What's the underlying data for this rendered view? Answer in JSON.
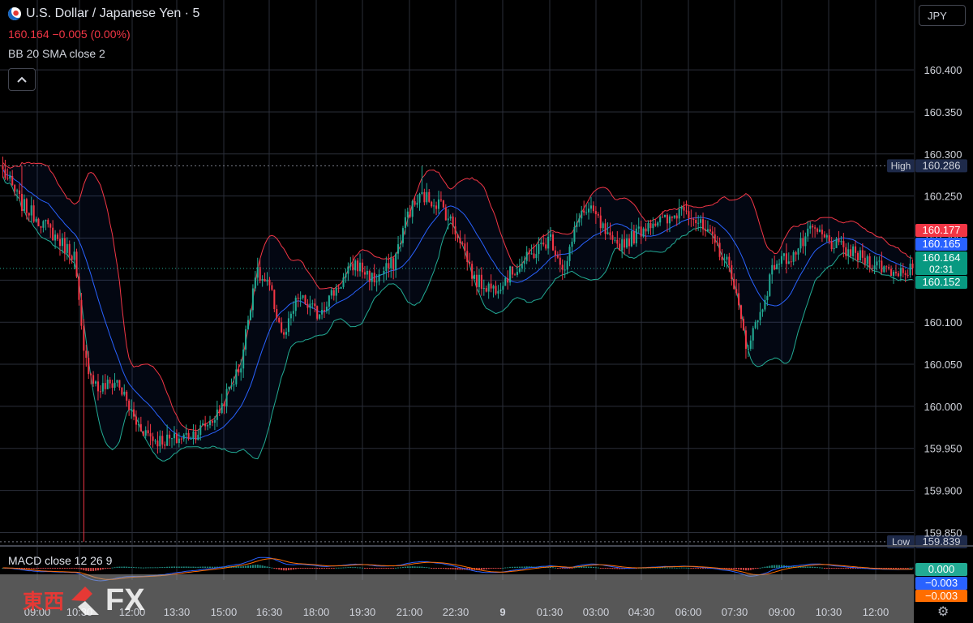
{
  "header": {
    "title": "U.S. Dollar / Japanese Yen · 5",
    "price_line": "160.164 −0.005 (0.00%)",
    "indicator": "BB 20 SMA close 2",
    "currency": "JPY"
  },
  "icons": {
    "flag": "usd-jpy-flag-icon",
    "collapse": "chevron-up-icon",
    "settings": "gear-icon"
  },
  "macd": {
    "label": "MACD close 12 26 9"
  },
  "logo": {
    "text": "東西",
    "suffix": "FX"
  },
  "colors": {
    "background": "#000000",
    "up": "#22ab94",
    "down": "#f23645",
    "bb_upper": "#f23645",
    "bb_basis": "#2962ff",
    "bb_lower": "#22ab94",
    "macd_line": "#2962ff",
    "signal_line": "#ff6d00",
    "high_low_label": "#1e2a4a"
  },
  "chart_data": {
    "type": "candlestick",
    "symbol": "USD/JPY",
    "interval": "5",
    "ylim": [
      159.835,
      160.43
    ],
    "y_ticks": [
      "160.400",
      "160.350",
      "160.300",
      "160.250",
      "160.200",
      "160.150",
      "160.100",
      "160.050",
      "160.000",
      "159.950",
      "159.900",
      "159.850"
    ],
    "x_ticks": [
      "09:00",
      "10:30",
      "12:00",
      "13:30",
      "15:00",
      "16:30",
      "18:00",
      "19:30",
      "21:00",
      "22:30",
      "9",
      "01:30",
      "03:00",
      "04:30",
      "06:00",
      "07:30",
      "09:00",
      "10:30",
      "12:00"
    ],
    "price_labels": [
      {
        "label": "High",
        "value": "160.286"
      },
      {
        "label": "Low",
        "value": "159.839"
      }
    ],
    "axis_markers": [
      {
        "value": "160.177",
        "color": "#f23645"
      },
      {
        "value": "160.165",
        "color": "#2962ff"
      },
      {
        "value": "160.164",
        "color": "#089981",
        "sub": "02:31"
      },
      {
        "value": "160.152",
        "color": "#089981"
      }
    ],
    "anchors": [
      [
        0,
        160.28
      ],
      [
        8,
        160.24
      ],
      [
        16,
        160.22
      ],
      [
        26,
        160.19
      ],
      [
        30,
        160.18
      ],
      [
        34,
        160.06
      ],
      [
        40,
        160.02
      ],
      [
        48,
        160.03
      ],
      [
        56,
        159.98
      ],
      [
        64,
        159.96
      ],
      [
        72,
        159.96
      ],
      [
        82,
        159.97
      ],
      [
        90,
        159.99
      ],
      [
        100,
        160.05
      ],
      [
        106,
        160.16
      ],
      [
        112,
        160.14
      ],
      [
        118,
        160.08
      ],
      [
        124,
        160.13
      ],
      [
        132,
        160.11
      ],
      [
        140,
        160.14
      ],
      [
        148,
        160.17
      ],
      [
        156,
        160.15
      ],
      [
        164,
        160.17
      ],
      [
        170,
        160.23
      ],
      [
        176,
        160.25
      ],
      [
        184,
        160.24
      ],
      [
        192,
        160.2
      ],
      [
        198,
        160.15
      ],
      [
        206,
        160.14
      ],
      [
        214,
        160.16
      ],
      [
        222,
        160.18
      ],
      [
        230,
        160.2
      ],
      [
        236,
        160.16
      ],
      [
        242,
        160.23
      ],
      [
        248,
        160.23
      ],
      [
        256,
        160.19
      ],
      [
        264,
        160.2
      ],
      [
        272,
        160.22
      ],
      [
        280,
        160.22
      ],
      [
        286,
        160.24
      ],
      [
        294,
        160.21
      ],
      [
        300,
        160.19
      ],
      [
        306,
        160.16
      ],
      [
        312,
        160.07
      ],
      [
        318,
        160.11
      ],
      [
        324,
        160.17
      ],
      [
        332,
        160.18
      ],
      [
        340,
        160.21
      ],
      [
        350,
        160.19
      ],
      [
        358,
        160.18
      ],
      [
        366,
        160.17
      ],
      [
        374,
        160.16
      ],
      [
        382,
        160.164
      ]
    ],
    "bollinger": {
      "period": 20,
      "stddev": 2,
      "source": "close"
    },
    "macd": {
      "fast": 12,
      "slow": 26,
      "signal": 9,
      "axis_markers": [
        {
          "value": "0.000",
          "color": "#22ab94"
        },
        {
          "value": "−0.003",
          "color": "#2962ff"
        },
        {
          "value": "−0.003",
          "color": "#ff6d00"
        }
      ]
    }
  }
}
